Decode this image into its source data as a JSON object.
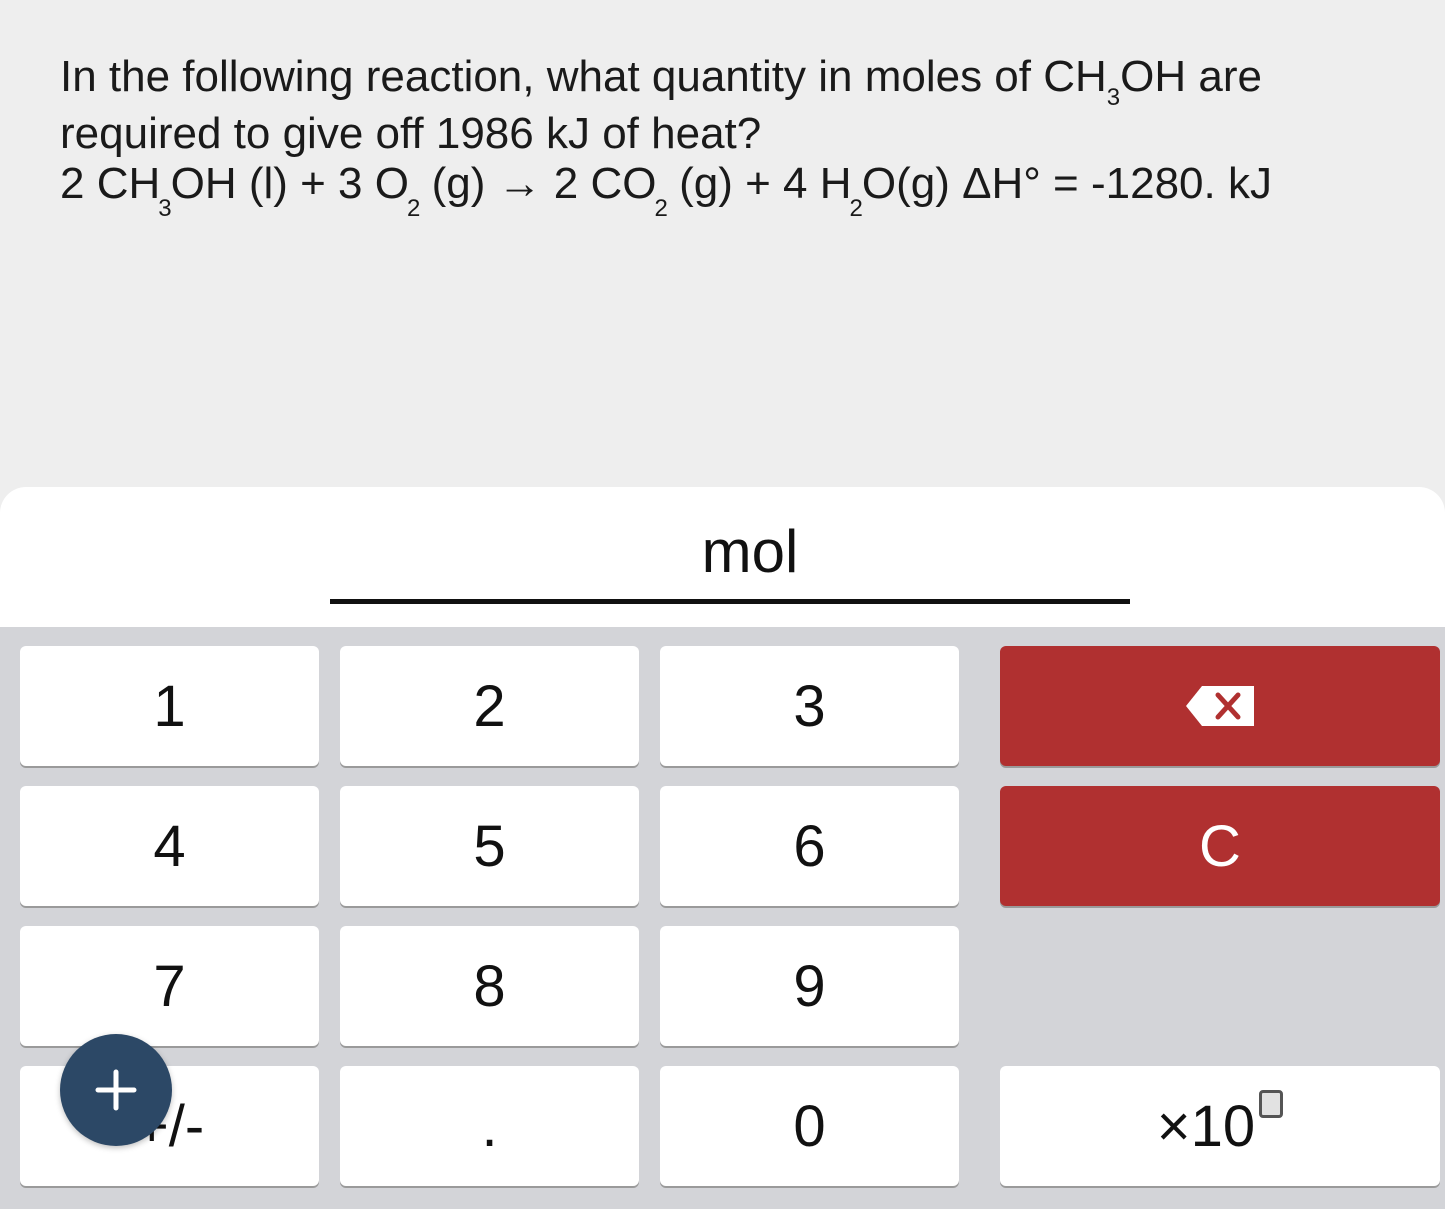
{
  "question": {
    "text_part1": "In the following reaction, what quantity in moles of CH",
    "sub_3": "3",
    "text_part2": "OH are",
    "line2": "required to give off 1986 kJ of heat?",
    "eq": {
      "coef1": "2 CH",
      "s1": "3",
      "t1": "OH (l) + 3 O",
      "s2": "2",
      "t2": " (g) → 2 CO",
      "s3": "2",
      "t3": " (g) + 4 H",
      "s4": "2",
      "t4": "O(g) ΔH° = -1280. kJ"
    }
  },
  "answer": {
    "unit": "mol",
    "value": ""
  },
  "keypad": {
    "k1": "1",
    "k2": "2",
    "k3": "3",
    "k4": "4",
    "k5": "5",
    "k6": "6",
    "k7": "7",
    "k8": "8",
    "k9": "9",
    "sign": "+/-",
    "dot": ".",
    "k0": "0",
    "clear": "C",
    "sci_prefix": "×10",
    "backspace_icon": "backspace-icon"
  },
  "fab": {
    "icon": "plus-icon",
    "label": "+"
  },
  "colors": {
    "red_key": "#b03030",
    "fab": "#2c4866",
    "keypad_bg": "#d3d4d8"
  }
}
